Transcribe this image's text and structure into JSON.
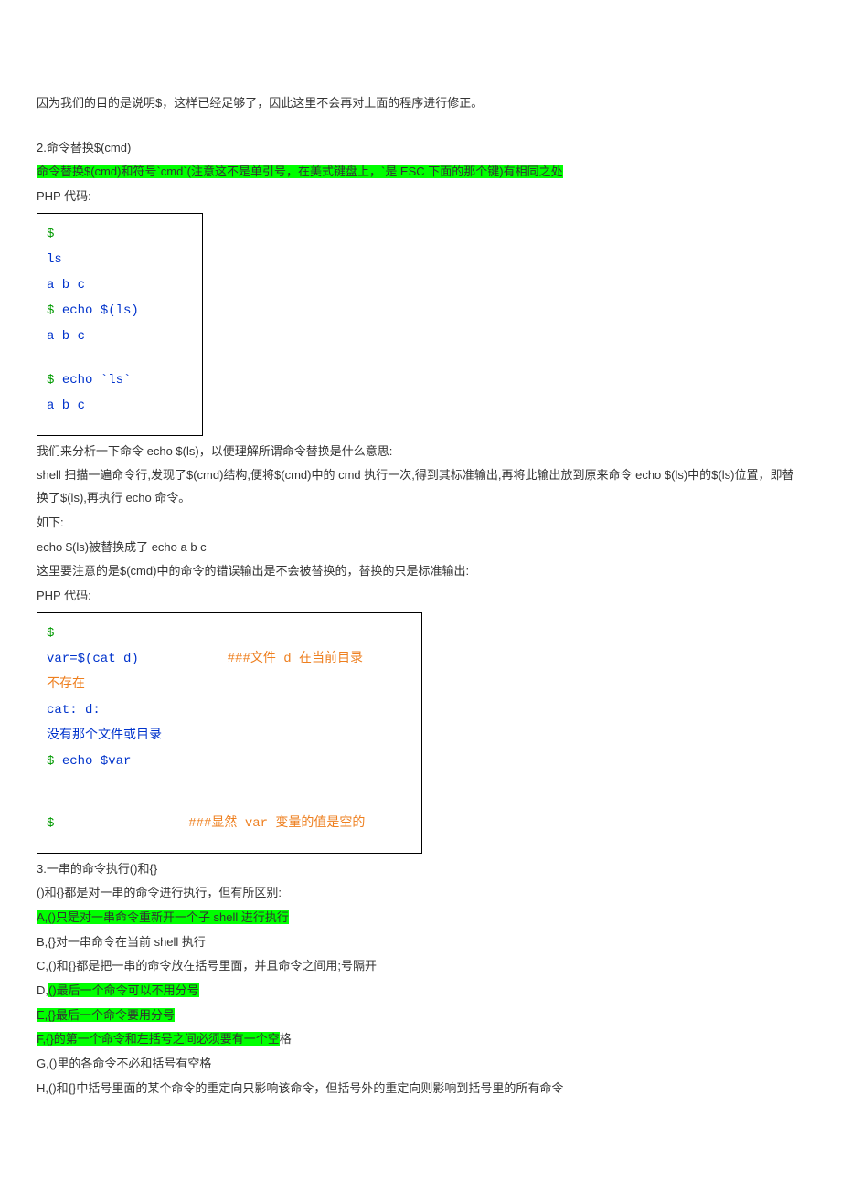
{
  "p_intro": "因为我们的目的是说明$，这样已经足够了，因此这里不会再对上面的程序进行修正。",
  "h_s2": "2.命令替换$(cmd)",
  "hl_s2": "命令替换$(cmd)和符号`cmd`(注意这不是单引号，在美式键盘上，`是 ESC 下面的那个键)有相同之处",
  "php_label1": "PHP 代码:",
  "code1": {
    "l1": "$",
    "l2": "ls",
    "l3": "a b c",
    "l4a": "$ ",
    "l4b": "echo $(ls)",
    "l5": "a b c",
    "l6a": "$ ",
    "l6b": "echo `ls`",
    "l7": "a b c"
  },
  "p_a1": "我们来分析一下命令 echo $(ls)，以便理解所谓命令替换是什么意思:",
  "p_a2": "shell 扫描一遍命令行,发现了$(cmd)结构,便将$(cmd)中的 cmd 执行一次,得到其标准输出,再将此输出放到原来命令 echo $(ls)中的$(ls)位置，即替换了$(ls),再执行 echo 命令。",
  "p_a3": "如下:",
  "p_a4": "echo $(ls)被替换成了 echo a b c",
  "p_a5": "这里要注意的是$(cmd)中的命令的错误输出是不会被替换的，替换的只是标准输出:",
  "php_label2": "PHP 代码:",
  "code2": {
    "l1": "$",
    "l2a": "var=$(cat d)",
    "l2b": "###文件 d 在当前目录",
    "l3": "不存在",
    "l4": "cat: d:",
    "l5": "没有那个文件或目录",
    "l6a": "$ ",
    "l6b": "echo $var",
    "l7a": "$",
    "l7b": "###显然 var 变量的值是空的"
  },
  "h_s3": "3.一串的命令执行()和{}",
  "p_b1": "()和{}都是对一串的命令进行执行，但有所区别:",
  "hl_A": "A,()只是对一串命令重新开一个子 shell 进行执行",
  "p_B": "B,{}对一串命令在当前 shell 执行",
  "p_C": "C,()和{}都是把一串的命令放在括号里面，并且命令之间用;号隔开",
  "p_D_pre": "D,",
  "hl_D": "()最后一个命令可以不用分号",
  "hl_E": "E,{}最后一个命令要用分号",
  "hl_F": "F,{}的第一个命令和左括号之间必须要有一个空",
  "p_F_post": "格",
  "p_G": "G,()里的各命令不必和括号有空格",
  "p_H": "H,()和{}中括号里面的某个命令的重定向只影响该命令，但括号外的重定向则影响到括号里的所有命令"
}
